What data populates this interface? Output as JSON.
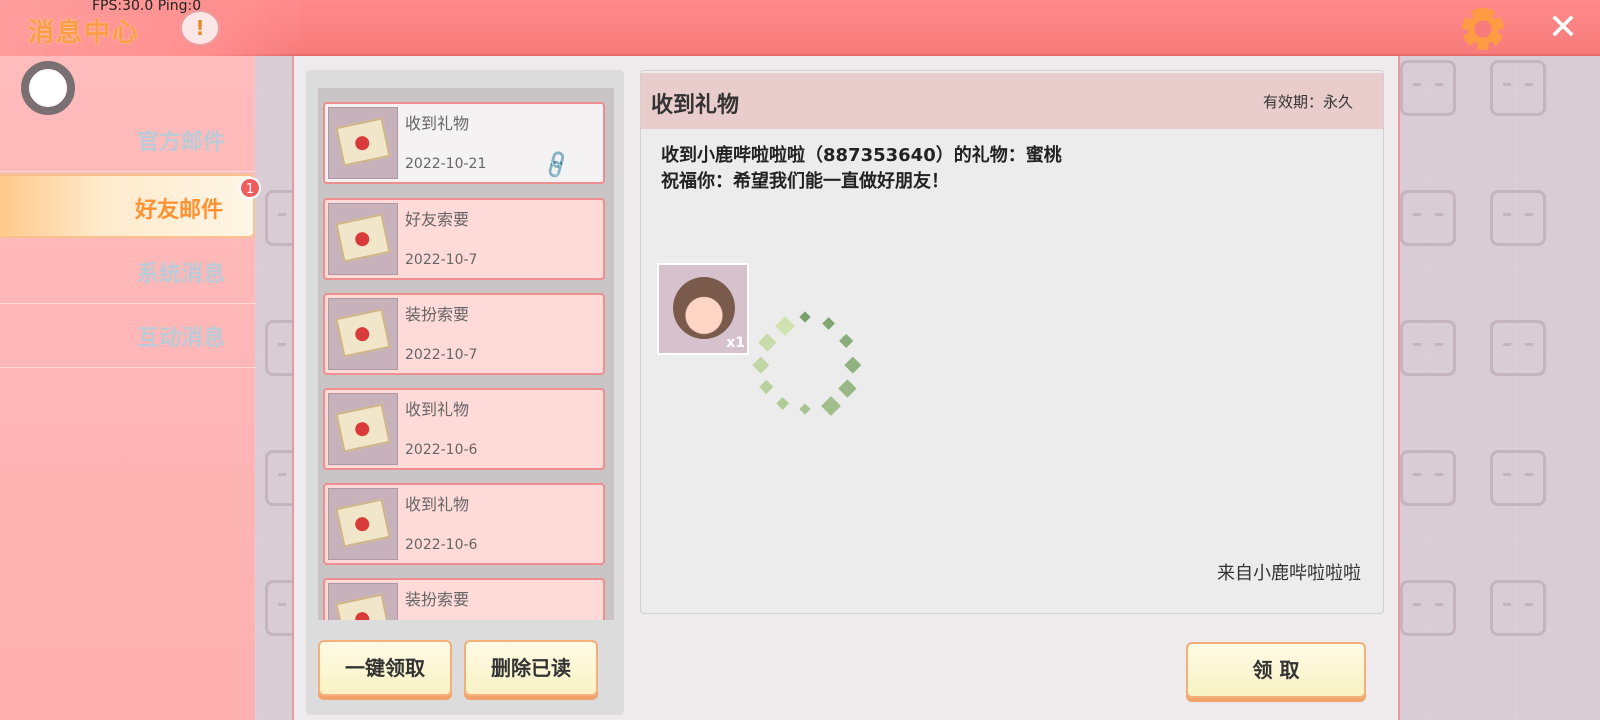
{
  "topbar": {
    "title": "消息中心",
    "fps": "FPS:30.0  Ping:0",
    "notice_glyph": "!",
    "settings_icon": "gear-icon",
    "close_icon": "close-icon",
    "close_glyph": "✕"
  },
  "sidebar": {
    "items": [
      {
        "label": "官方邮件",
        "active": false
      },
      {
        "label": "好友邮件",
        "active": true,
        "badge": "1"
      },
      {
        "label": "系统消息",
        "active": false
      },
      {
        "label": "互动消息",
        "active": false
      }
    ]
  },
  "mail_list": {
    "items": [
      {
        "title": "收到礼物",
        "date": "2022-10-21",
        "selected": true,
        "has_attachment": true
      },
      {
        "title": "好友索要",
        "date": "2022-10-7",
        "selected": false
      },
      {
        "title": "装扮索要",
        "date": "2022-10-7",
        "selected": false
      },
      {
        "title": "收到礼物",
        "date": "2022-10-6",
        "selected": false
      },
      {
        "title": "收到礼物",
        "date": "2022-10-6",
        "selected": false
      },
      {
        "title": "装扮索要",
        "date": "",
        "selected": false
      }
    ],
    "claim_all_label": "一键领取",
    "delete_read_label": "删除已读"
  },
  "detail": {
    "title": "收到礼物",
    "validity": "有效期：永久",
    "body_line1": "收到小鹿哔啦啦啦（887353640）的礼物：蜜桃",
    "body_line2": "祝福你：希望我们能一直做好朋友！",
    "gift_count": "x1",
    "from": "来自小鹿哔啦啦啦",
    "claim_label": "领 取"
  },
  "colors": {
    "accent_orange": "#ff9334",
    "topbar": "#f77b7b",
    "card_border": "#ee8f8f"
  }
}
